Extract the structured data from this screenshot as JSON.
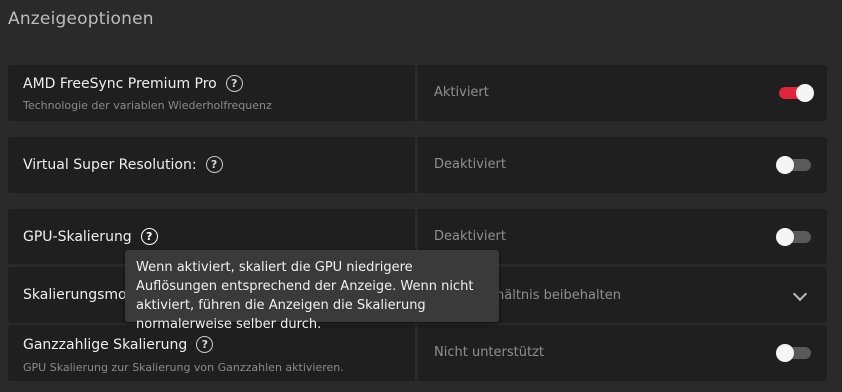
{
  "section": {
    "title": "Anzeigeoptionen"
  },
  "rows": [
    {
      "label": "AMD FreeSync Premium Pro",
      "sub": "Technologie der variablen Wiederholfrequenz",
      "value": "Aktiviert",
      "toggle": "on"
    },
    {
      "label": "Virtual Super Resolution:",
      "value": "Deaktiviert",
      "toggle": "off"
    },
    {
      "label": "GPU-Skalierung",
      "value": "Deaktiviert",
      "toggle": "off"
    },
    {
      "label": "Skalierungsmodus",
      "value": "Seitenverhältnis beibehalten"
    },
    {
      "label": "Ganzzahlige Skalierung",
      "sub": "GPU Skalierung zur Skalierung von Ganzzahlen aktivieren.",
      "value": "Nicht unterstützt",
      "toggle": "off"
    }
  ],
  "tooltip": {
    "text": "Wenn aktiviert, skaliert die GPU niedrigere Auflösungen entsprechend der Anzeige. Wenn nicht aktiviert, führen die Anzeigen die Skalierung normalerweise selber durch."
  },
  "help_glyph": "?",
  "colors": {
    "accent": "#e0263a",
    "background": "#2a2a2a",
    "panel": "#1f1f1f"
  }
}
